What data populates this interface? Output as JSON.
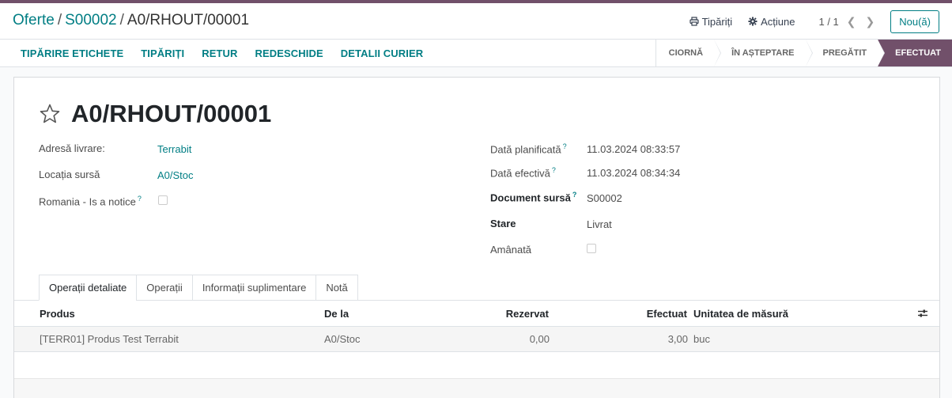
{
  "breadcrumb": {
    "root": "Oferte",
    "parent": "S00002",
    "current": "A0/RHOUT/00001"
  },
  "control": {
    "print_label": "Tipăriți",
    "action_label": "Acțiune",
    "pager": "1 / 1",
    "new_label": "Nou(ă)"
  },
  "action_buttons": [
    "TIPĂRIRE ETICHETE",
    "TIPĂRIȚI",
    "RETUR",
    "REDESCHIDE",
    "DETALII CURIER"
  ],
  "statusbar": {
    "stages": [
      "CIORNĂ",
      "ÎN AȘTEPTARE",
      "PREGĂTIT",
      "EFECTUAT"
    ],
    "active_index": 3
  },
  "record": {
    "title": "A0/RHOUT/00001",
    "left_fields": {
      "delivery_address": {
        "label": "Adresă livrare:",
        "value": "Terrabit"
      },
      "source_location": {
        "label": "Locația sursă",
        "value": "A0/Stoc"
      },
      "romania_notice": {
        "label": "Romania - Is a notice",
        "help": "?",
        "checked": false
      }
    },
    "right_fields": {
      "scheduled_date": {
        "label": "Dată planificată",
        "help": "?",
        "value": "11.03.2024 08:33:57"
      },
      "effective_date": {
        "label": "Dată efectivă",
        "help": "?",
        "value": "11.03.2024 08:34:34"
      },
      "source_document": {
        "label": "Document sursă",
        "help": "?",
        "value": "S00002"
      },
      "state": {
        "label": "Stare",
        "value": "Livrat"
      },
      "postponed": {
        "label": "Amânată",
        "checked": false
      }
    }
  },
  "tabs": [
    "Operații detaliate",
    "Operații",
    "Informații suplimentare",
    "Notă"
  ],
  "active_tab": 0,
  "table": {
    "headers": {
      "product": "Produs",
      "from": "De la",
      "reserved": "Rezervat",
      "done": "Efectuat",
      "uom": "Unitatea de măsură"
    },
    "rows": [
      {
        "product": "[TERR01] Produs Test Terrabit",
        "from": "A0/Stoc",
        "reserved": "0,00",
        "done": "3,00",
        "uom": "buc"
      }
    ]
  },
  "colors": {
    "brand": "#71506a",
    "link": "#017e84"
  }
}
